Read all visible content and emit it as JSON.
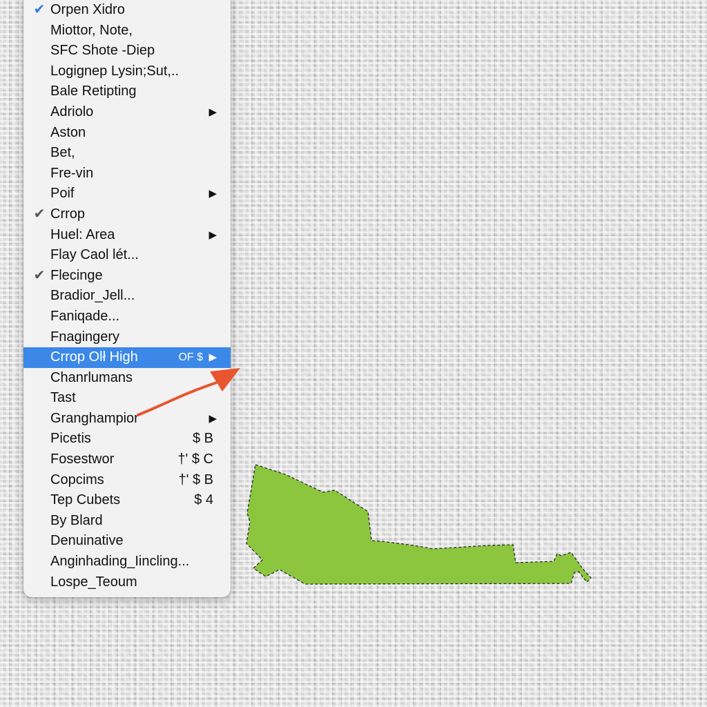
{
  "context_menu": {
    "items": [
      {
        "label": "Orpen Xidro",
        "check": "blue",
        "submenu": false,
        "shortcut": ""
      },
      {
        "label": "Miottor, Note,",
        "check": "",
        "submenu": false,
        "shortcut": ""
      },
      {
        "label": "SFC Shote -Diep",
        "check": "",
        "submenu": false,
        "shortcut": ""
      },
      {
        "label": "Logignep Lysin;Sut,..",
        "check": "",
        "submenu": false,
        "shortcut": ""
      },
      {
        "label": "Bale Retipting",
        "check": "",
        "submenu": false,
        "shortcut": ""
      },
      {
        "label": "Adriolo",
        "check": "",
        "submenu": true,
        "shortcut": ""
      },
      {
        "label": "Aston",
        "check": "",
        "submenu": false,
        "shortcut": ""
      },
      {
        "label": "Bet,",
        "check": "",
        "submenu": false,
        "shortcut": ""
      },
      {
        "label": "Fre-vin",
        "check": "",
        "submenu": false,
        "shortcut": ""
      },
      {
        "label": "Poif",
        "check": "",
        "submenu": true,
        "shortcut": ""
      },
      {
        "label": "Crrop",
        "check": "gray",
        "submenu": false,
        "shortcut": ""
      },
      {
        "label": "Huel: Area",
        "check": "",
        "submenu": true,
        "shortcut": ""
      },
      {
        "label": "Flay Caol lét...",
        "check": "",
        "submenu": false,
        "shortcut": ""
      },
      {
        "label": "Flecinge",
        "check": "gray",
        "submenu": false,
        "shortcut": ""
      },
      {
        "label": "Bradior_Jell...",
        "check": "",
        "submenu": false,
        "shortcut": ""
      },
      {
        "label": "Faniqade...",
        "check": "",
        "submenu": false,
        "shortcut": ""
      },
      {
        "label": "Fnagingery",
        "check": "",
        "submenu": false,
        "shortcut": ""
      },
      {
        "label": "Crrop Olł High",
        "check": "",
        "submenu": true,
        "shortcut": "OF $",
        "highlighted": true
      },
      {
        "label": "Chanrlumans",
        "check": "",
        "submenu": false,
        "shortcut": ""
      },
      {
        "label": "Tast",
        "check": "",
        "submenu": false,
        "shortcut": ""
      },
      {
        "label": "Granghampior",
        "check": "",
        "submenu": true,
        "shortcut": ""
      },
      {
        "label": "Picetis",
        "check": "",
        "submenu": false,
        "shortcut": "$ B"
      },
      {
        "label": "Fosestwor",
        "check": "",
        "submenu": false,
        "shortcut": "†' $ C"
      },
      {
        "label": "Copcims",
        "check": "",
        "submenu": false,
        "shortcut": "†' $ B"
      },
      {
        "label": "Tep Cubets",
        "check": "",
        "submenu": false,
        "shortcut": "$ 4"
      },
      {
        "label": "By Blard",
        "check": "",
        "submenu": false,
        "shortcut": ""
      },
      {
        "label": "Denuinative",
        "check": "",
        "submenu": false,
        "shortcut": ""
      },
      {
        "label": "Anginhading_Iincling...",
        "check": "",
        "submenu": false,
        "shortcut": ""
      },
      {
        "label": "Lospe_Teoum",
        "check": "",
        "submenu": false,
        "shortcut": ""
      }
    ],
    "check_glyph": "✔",
    "submenu_glyph": "▶"
  },
  "annotation": {
    "icon": "arrow-annotation-icon",
    "color": "#e8552e"
  },
  "selection": {
    "icon": "crop-selection-region",
    "fill_color": "#8cc63f",
    "outline_color": "#2b2b2b"
  }
}
